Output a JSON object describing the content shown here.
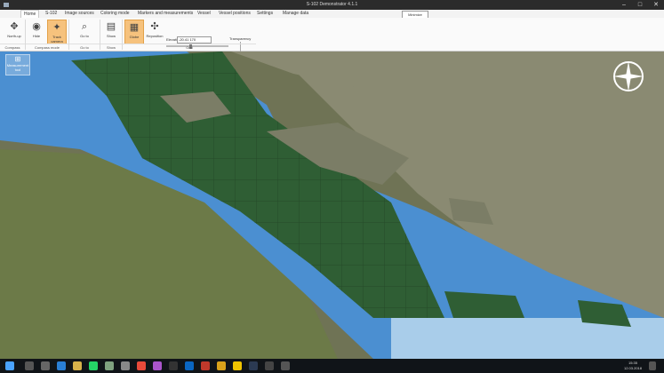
{
  "window": {
    "title": "S-102 Demonstrator 4.1.1",
    "minimize": "–",
    "maximize": "□",
    "close": "✕"
  },
  "tooltip": "Minimize",
  "menu": {
    "tabs": [
      "Home",
      "S-102",
      "Image sources",
      "Coloring mode",
      "Markers and measurements",
      "Vessel",
      "Vessel positions",
      "Settings",
      "Manage data"
    ],
    "active": "Home"
  },
  "ribbon": {
    "north_up": "North-up",
    "hide": "Hide",
    "track_camera": "Track camera",
    "goto": "Go to",
    "show": "Show",
    "globe": "Globe",
    "reposition": "Reposition",
    "elevation_label": "Elevation",
    "elevation_value": "-20.41 170",
    "transparency_label": "Transparency",
    "groups": {
      "compass": "Compass",
      "compass_mode": "Compass mode",
      "goto": "Go to",
      "grid": "Grid"
    }
  },
  "map": {
    "measurement_tool": "Measurement tool"
  },
  "taskbar": {
    "time": "15:35",
    "date": "12.03.2018"
  },
  "colors": {
    "land": "#7a7a58",
    "shallow_water": "#4b8fd1",
    "deep_water": "#2f6fb3",
    "fairway_green": "#2f5e34",
    "ribbon_bg": "#fafafa",
    "highlight": "#f6c27d"
  }
}
